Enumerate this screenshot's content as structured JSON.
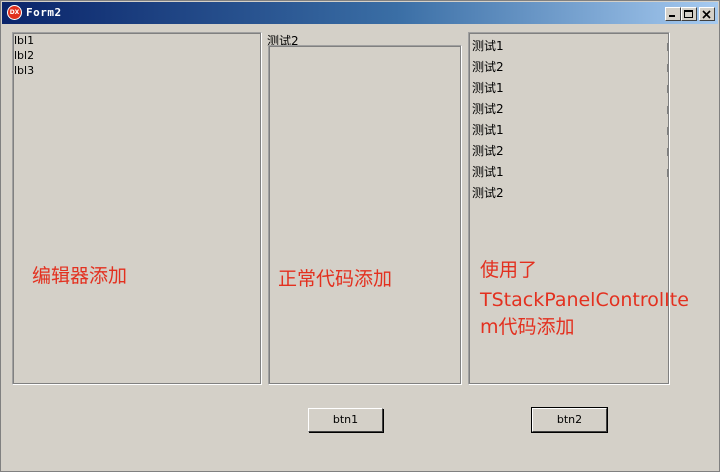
{
  "window": {
    "title": "Form2",
    "icon_text": "DX",
    "controls": [
      "minimize-icon",
      "maximize-icon",
      "close-icon"
    ]
  },
  "panel1": {
    "labels": [
      "lbl1",
      "lbl2",
      "lbl3"
    ],
    "caption": "编辑器添加"
  },
  "panel2": {
    "label": "测试2",
    "caption": "正常代码添加"
  },
  "panel3": {
    "items": [
      "测试1",
      "测试2",
      "测试1",
      "测试2",
      "测试1",
      "测试2",
      "测试1",
      "测试2"
    ],
    "caption_lines": [
      "使用了",
      "TStackPanelControlIte",
      "m代码添加"
    ]
  },
  "buttons": {
    "btn1": "btn1",
    "btn2": "btn2"
  },
  "colors": {
    "caption_red": "#e3301f",
    "window_bg": "#d4d0c8"
  }
}
